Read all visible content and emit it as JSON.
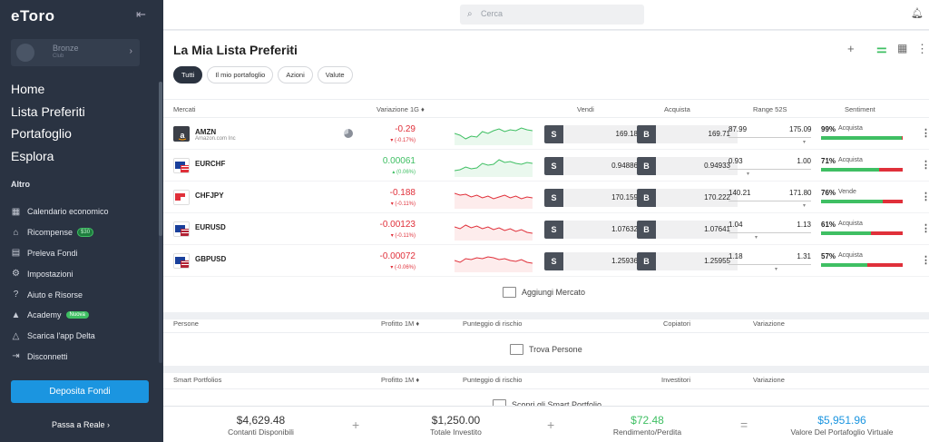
{
  "sidebar": {
    "logo": "eToro",
    "account": {
      "name": "Bronze",
      "sub": "Club"
    },
    "main_nav": [
      "Home",
      "Lista Preferiti",
      "Portafoglio",
      "Esplora"
    ],
    "section_title": "Altro",
    "sub_nav": [
      {
        "label": "Calendario economico",
        "icon": "calendar-icon",
        "glyph": "▦"
      },
      {
        "label": "Ricompense",
        "icon": "gift-icon",
        "glyph": "⌂",
        "badge": "$30"
      },
      {
        "label": "Preleva Fondi",
        "icon": "wallet-icon",
        "glyph": "▤"
      },
      {
        "label": "Impostazioni",
        "icon": "gear-icon",
        "glyph": "⚙"
      },
      {
        "label": "Aiuto e Risorse",
        "icon": "help-icon",
        "glyph": "?"
      },
      {
        "label": "Academy",
        "icon": "graduation-cap-icon",
        "glyph": "▲",
        "badge": "Nuova"
      },
      {
        "label": "Scarica l'app Delta",
        "icon": "delta-icon",
        "glyph": "△"
      },
      {
        "label": "Disconnetti",
        "icon": "logout-icon",
        "glyph": "⇥"
      }
    ],
    "deposit_label": "Deposita Fondi",
    "real_label": "Passa a Reale ›"
  },
  "topbar": {
    "search_placeholder": "Cerca"
  },
  "watchlist": {
    "title": "La Mia Lista Preferiti",
    "tabs": [
      "Tutti",
      "Il mio portafoglio",
      "Azioni",
      "Valute"
    ],
    "active_tab": "Tutti",
    "headers": {
      "markets": "Mercati",
      "change": "Variazione 1G ♦",
      "sell": "Vendi",
      "buy": "Acquista",
      "range": "Range 52S",
      "sentiment": "Sentiment"
    },
    "rows": [
      {
        "symbol": "AMZN",
        "name": "Amazon.com Inc",
        "change": "-0.29",
        "change_pct": "▾ (-0.17%)",
        "trend": "up",
        "spark": [
          12,
          14,
          18,
          15,
          16,
          10,
          12,
          9,
          7,
          10,
          8,
          9,
          6,
          8,
          9
        ],
        "sell": "169.18",
        "buy": "169.71",
        "range_low": "87.99",
        "range_high": "175.09",
        "range_pos": 0.96,
        "sentiment_pct": "99%",
        "sentiment_label": "Acquista",
        "sentiment_value": 0.99,
        "flag": "amzn"
      },
      {
        "symbol": "EURCHF",
        "name": "",
        "change": "0.00061",
        "change_pct": "▴ (0.06%)",
        "trend": "up",
        "spark": [
          18,
          17,
          14,
          16,
          15,
          10,
          12,
          11,
          6,
          9,
          8,
          10,
          11,
          9,
          10
        ],
        "sell": "0.94886",
        "buy": "0.94933",
        "range_low": "0.93",
        "range_high": "1.00",
        "range_pos": 0.25,
        "sentiment_pct": "71%",
        "sentiment_label": "Acquista",
        "sentiment_value": 0.71,
        "flag": "eu-ch"
      },
      {
        "symbol": "CHFJPY",
        "name": "",
        "change": "-0.188",
        "change_pct": "▾ (-0.11%)",
        "trend": "down",
        "spark": [
          8,
          10,
          9,
          12,
          10,
          13,
          11,
          14,
          12,
          10,
          13,
          11,
          14,
          12,
          13
        ],
        "sell": "170.159",
        "buy": "170.222",
        "range_low": "140.21",
        "range_high": "171.80",
        "range_pos": 0.95,
        "sentiment_pct": "76%",
        "sentiment_label": "Vende",
        "sentiment_value": 0.76,
        "flag": "ch-jp"
      },
      {
        "symbol": "EURUSD",
        "name": "",
        "change": "-0.00123",
        "change_pct": "▾ (-0.11%)",
        "trend": "down",
        "spark": [
          10,
          12,
          8,
          11,
          9,
          12,
          10,
          13,
          11,
          14,
          12,
          15,
          13,
          16,
          17
        ],
        "sell": "1.07632",
        "buy": "1.07641",
        "range_low": "1.04",
        "range_high": "1.13",
        "range_pos": 0.35,
        "sentiment_pct": "61%",
        "sentiment_label": "Acquista",
        "sentiment_value": 0.61,
        "flag": "eu-us"
      },
      {
        "symbol": "GBPUSD",
        "name": "",
        "change": "-0.00072",
        "change_pct": "▾ (-0.06%)",
        "trend": "down",
        "spark": [
          12,
          14,
          10,
          11,
          9,
          10,
          8,
          9,
          11,
          10,
          12,
          13,
          11,
          14,
          15
        ],
        "sell": "1.25936",
        "buy": "1.25955",
        "range_low": "1.18",
        "range_high": "1.31",
        "range_pos": 0.6,
        "sentiment_pct": "57%",
        "sentiment_label": "Acquista",
        "sentiment_value": 0.57,
        "flag": "gb-us"
      }
    ],
    "add_market": "Aggiungi Mercato"
  },
  "people": {
    "headers": [
      "Persone",
      "Profitto 1M ♦",
      "Punteggio di rischio",
      "Copiatori",
      "Variazione"
    ],
    "find": "Trova Persone"
  },
  "smart": {
    "headers": [
      "Smart Portfolios",
      "Profitto 1M ♦",
      "Punteggio di rischio",
      "Investitori",
      "Variazione"
    ],
    "find": "Scopri gli Smart Portfolio"
  },
  "footer": {
    "items": [
      {
        "value": "$4,629.48",
        "label": "Contanti Disponibili"
      },
      {
        "value": "$1,250.00",
        "label": "Totale Investito"
      },
      {
        "value": "$72.48",
        "label": "Rendimento/Perdita"
      },
      {
        "value": "$5,951.96",
        "label": "Valore Del Portafoglio Virtuale"
      }
    ],
    "ops": [
      "+",
      "+",
      "="
    ]
  },
  "colors": {
    "green": "#3fbf63",
    "red": "#e0303a",
    "blue": "#1b95e0",
    "sidebar": "#2a3342"
  }
}
